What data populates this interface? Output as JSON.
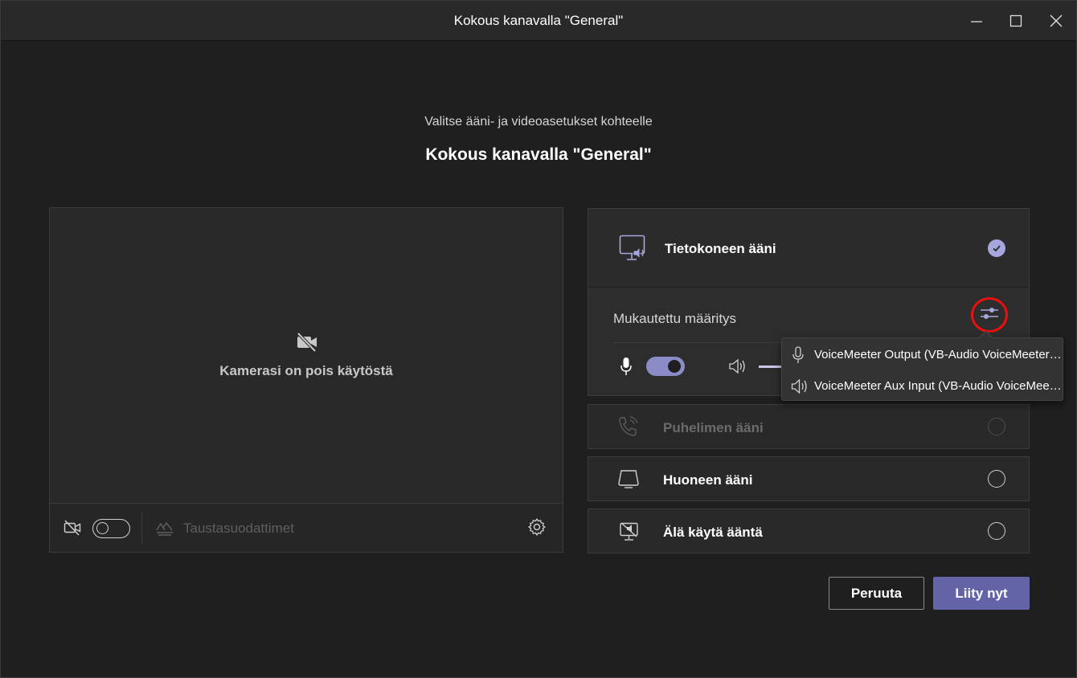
{
  "window": {
    "title": "Kokous kanavalla \"General\"",
    "controls": [
      "minimize-icon",
      "maximize-icon",
      "close-icon"
    ]
  },
  "header": {
    "subtitle": "Valitse ääni- ja videoasetukset kohteelle",
    "meeting_title": "Kokous kanavalla \"General\""
  },
  "video": {
    "camera_off_text": "Kamerasi on pois käytöstä",
    "camera_toggle": "off",
    "background_filters_label": "Taustasuodattimet"
  },
  "audio": {
    "options": [
      {
        "label": "Tietokoneen ääni",
        "icon": "computer-audio-icon",
        "selected": true
      },
      {
        "label": "Puhelimen ääni",
        "icon": "phone-audio-icon",
        "selected": false,
        "disabled": true
      },
      {
        "label": "Huoneen ääni",
        "icon": "room-audio-icon",
        "selected": false
      },
      {
        "label": "Älä käytä ääntä",
        "icon": "no-audio-icon",
        "selected": false
      }
    ],
    "custom_setup_label": "Mukautettu määritys",
    "mic_toggle": "on"
  },
  "device_popup": {
    "microphone": "VoiceMeeter Output (VB-Audio VoiceMeeter VAIO)",
    "speaker": "VoiceMeeter Aux Input (VB-Audio VoiceMeeter AUX VAIO)"
  },
  "actions": {
    "cancel_label": "Peruuta",
    "join_label": "Liity nyt"
  },
  "colors": {
    "accent": "#6264a7",
    "accent_light": "#a6a7dc",
    "highlight_circle": "#e81010",
    "background": "#1f1f1f"
  }
}
